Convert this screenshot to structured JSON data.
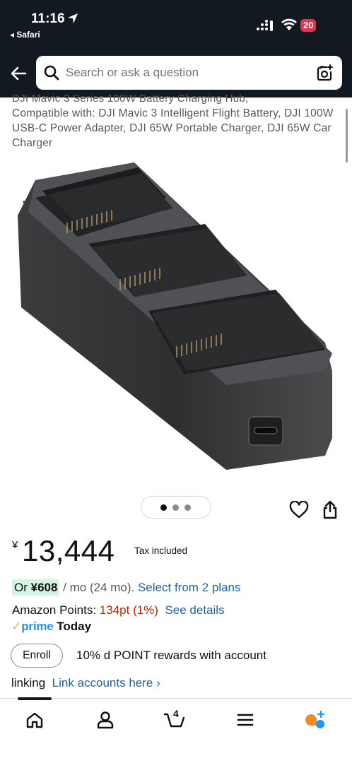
{
  "status_bar": {
    "time": "11:16",
    "back_app": "◂ Safari",
    "battery": "20"
  },
  "search": {
    "placeholder": "Search or ask a question"
  },
  "product": {
    "title_partial": "DJI Mavic 3 Series 100W Battery Charging Hub,",
    "description": "Compatible with: DJI Mavic 3 Intelligent Flight Battery, DJI 100W USB-C Power Adapter, DJI 65W Portable Charger, DJI 65W Car Charger"
  },
  "carousel": {
    "total": 3,
    "active": 1
  },
  "price": {
    "symbol": "¥",
    "amount": "13,444",
    "tax_note": "Tax included"
  },
  "installment": {
    "prefix": "Or ",
    "amount": "¥608",
    "term": " / mo (24 mo). ",
    "link": "Select from 2 plans"
  },
  "points": {
    "label": "Amazon Points: ",
    "value": "134pt",
    "percent": "(1%)",
    "link": "See details"
  },
  "prime": {
    "check": "✓",
    "word": "prime",
    "day": "Today"
  },
  "reward": {
    "enroll_label": "Enroll",
    "text": "10% d POINT rewards with account",
    "line2": "linking",
    "link": "Link accounts here ›"
  },
  "nav": {
    "items": [
      "home-icon",
      "account-icon",
      "cart-icon",
      "menu-icon",
      "rufus-icon"
    ],
    "cart_count": "4"
  },
  "colors": {
    "header_bg": "#131921",
    "link": "#2162a1",
    "price_red": "#b12704",
    "prime_blue": "#1a98ff",
    "badge_green": "#d6f2e2"
  }
}
